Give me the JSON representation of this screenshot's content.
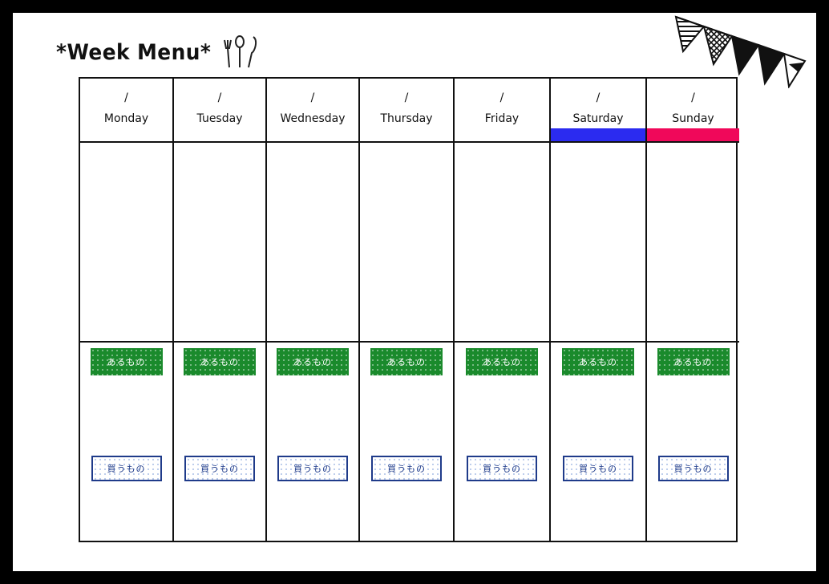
{
  "title": "*Week Menu*",
  "decor": {
    "cutlery_icon": "fork-spoon-knife-icon",
    "bunting_icon": "bunting-flags-icon"
  },
  "days": [
    {
      "date": "/",
      "name": "Monday",
      "have_label": "あるもの",
      "buy_label": "買うもの",
      "accent": null
    },
    {
      "date": "/",
      "name": "Tuesday",
      "have_label": "あるもの",
      "buy_label": "買うもの",
      "accent": null
    },
    {
      "date": "/",
      "name": "Wednesday",
      "have_label": "あるもの",
      "buy_label": "買うもの",
      "accent": null
    },
    {
      "date": "/",
      "name": "Thursday",
      "have_label": "あるもの",
      "buy_label": "買うもの",
      "accent": null
    },
    {
      "date": "/",
      "name": "Friday",
      "have_label": "あるもの",
      "buy_label": "買うもの",
      "accent": null
    },
    {
      "date": "/",
      "name": "Saturday",
      "have_label": "あるもの",
      "buy_label": "買うもの",
      "accent": "#2b2bf0"
    },
    {
      "date": "/",
      "name": "Sunday",
      "have_label": "あるもの",
      "buy_label": "買うもの",
      "accent": "#f0085a"
    }
  ],
  "colors": {
    "have_bg": "#1a8a2c",
    "buy_border": "#1f3b8a",
    "saturday": "#2b2bf0",
    "sunday": "#f0085a"
  }
}
